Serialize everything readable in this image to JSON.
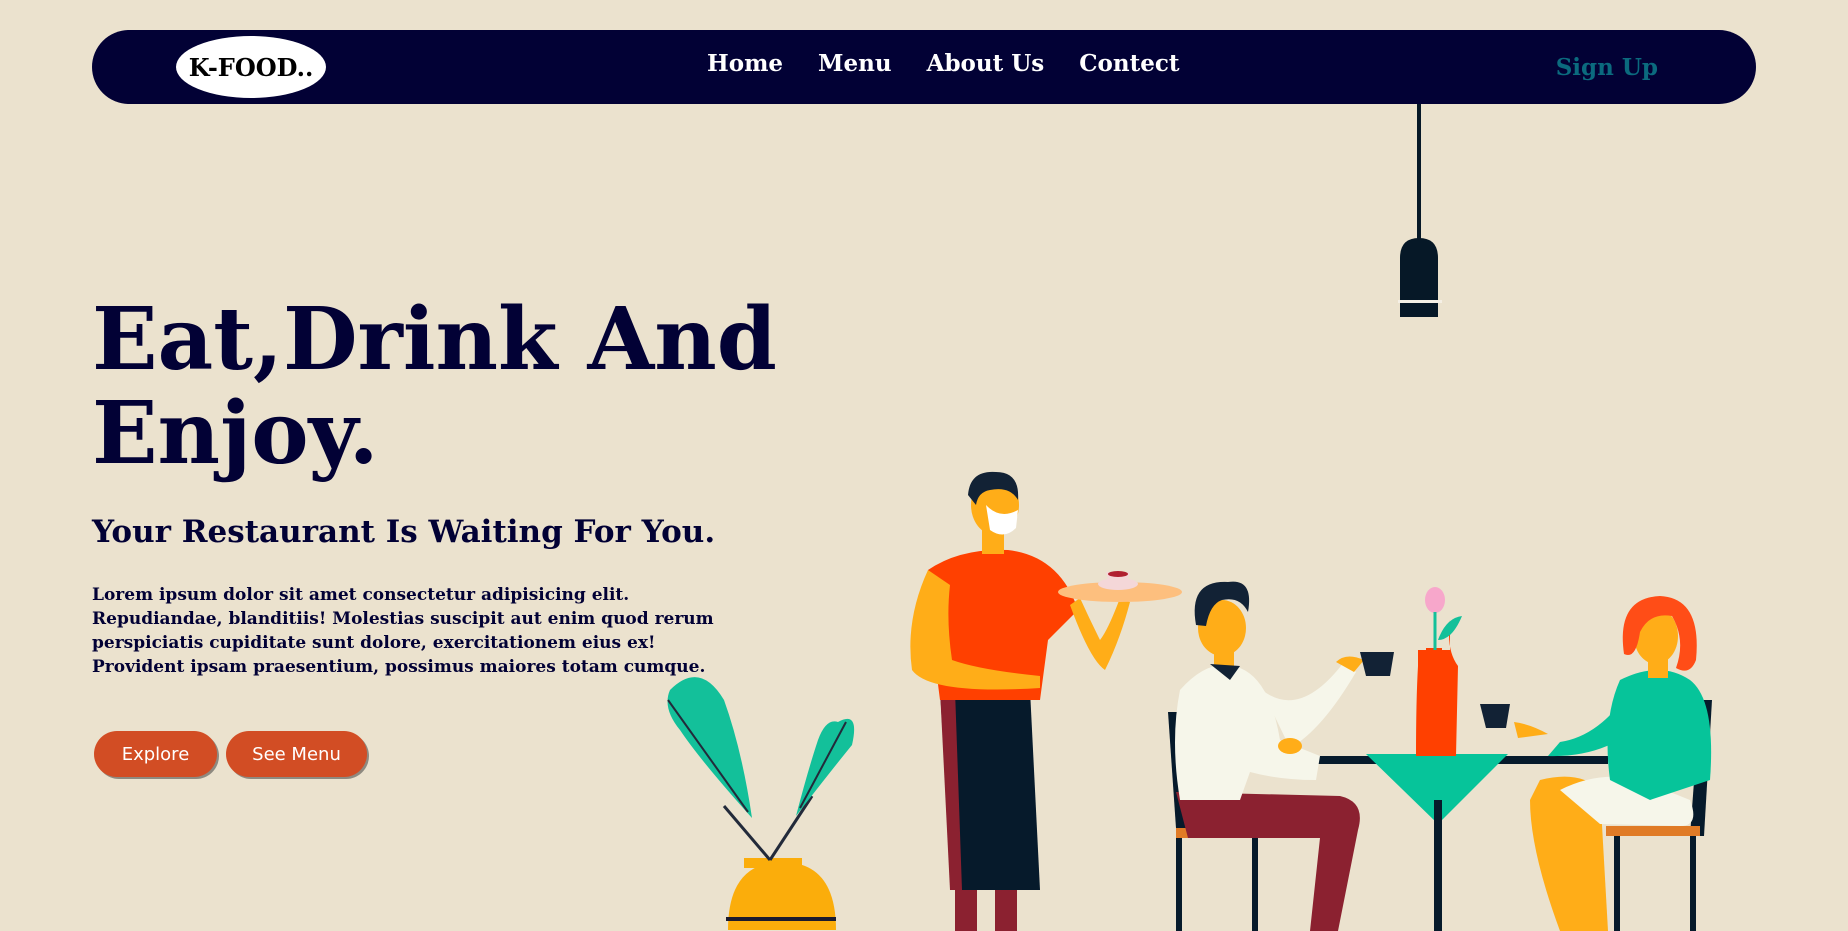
{
  "header": {
    "logo_text": "K-FOOD..",
    "nav": [
      "Home",
      "Menu",
      "About Us",
      "Contect"
    ],
    "signup_label": "Sign Up"
  },
  "hero": {
    "title_line1": "Eat,Drink And",
    "title_line2": "Enjoy.",
    "subtitle": "Your Restaurant Is Waiting For You.",
    "body": "Lorem ipsum dolor sit amet consectetur adipisicing elit. Repudiandae, blanditiis! Molestias suscipit aut enim quod rerum perspiciatis cupiditate sunt dolore, exercitationem eius ex! Provident ipsam praesentium, possimus maiores totam cumque.",
    "explore_label": "Explore",
    "see_menu_label": "See Menu"
  },
  "colors": {
    "background": "#ebe2ce",
    "navbar": "#020135",
    "accent": "#d24d24",
    "signup": "#0b6a7e"
  },
  "illustration": {
    "icon": "restaurant-scene-illustration"
  }
}
